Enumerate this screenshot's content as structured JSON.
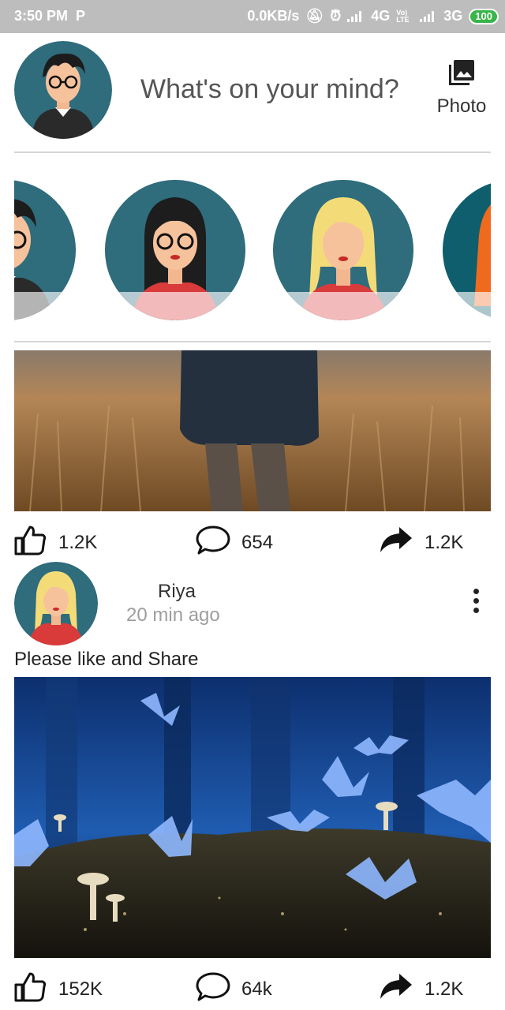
{
  "status_bar": {
    "time": "3:50 PM",
    "carrier_icon": "P",
    "net_speed": "0.0KB/s",
    "network1": "4G",
    "volte": "Vo) LTE",
    "network2": "3G",
    "battery": "100"
  },
  "composer": {
    "placeholder": "What's on your mind?",
    "photo_label": "Photo",
    "photo_icon": "photo-library-icon"
  },
  "stories": [
    {
      "name": "story-man-glasses"
    },
    {
      "name": "story-woman-glasses"
    },
    {
      "name": "story-blonde-woman"
    },
    {
      "name": "story-redhead-woman"
    }
  ],
  "post1": {
    "likes": "1.2K",
    "comments": "654",
    "shares": "1.2K"
  },
  "post2": {
    "author": "Riya",
    "time": "20 min ago",
    "caption": "Please like and Share",
    "likes": "152K",
    "comments": "64k",
    "shares": "1.2K"
  },
  "colors": {
    "avatar_bg": "#2f6c7c",
    "divider": "#d6d6d6",
    "status_bar": "#bdbdbd"
  }
}
